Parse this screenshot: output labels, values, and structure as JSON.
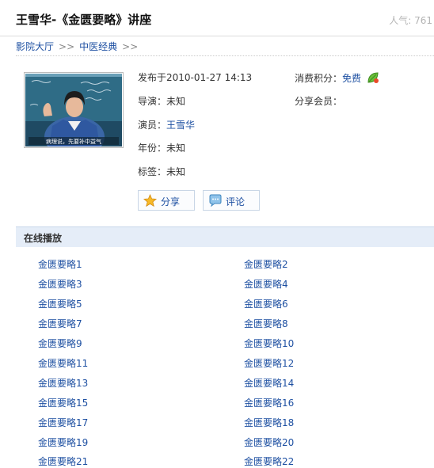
{
  "header": {
    "title": "王雪华-《金匮要略》讲座",
    "views_label": "人气",
    "views": "761"
  },
  "breadcrumb": {
    "items": [
      "影院大厅",
      "中医经典"
    ],
    "separator": ">>"
  },
  "poster": {
    "caption": "病理说，先要补中益气"
  },
  "info": {
    "published_label": "发布于",
    "published": "2010-01-27 14:13",
    "cost_label": "消费积分：",
    "cost_value": "免费",
    "director_label": "导演：",
    "director": "未知",
    "sharer_label": "分享会员：",
    "actor_label": "演员：",
    "actor": "王雪华",
    "year_label": "年份：",
    "year": "未知",
    "tags_label": "标签：",
    "tags": "未知"
  },
  "actions": {
    "share": "分享",
    "comment": "评论"
  },
  "online": {
    "heading": "在线播放",
    "episodes": [
      "金匮要略1",
      "金匮要略2",
      "金匮要略3",
      "金匮要略4",
      "金匮要略5",
      "金匮要略6",
      "金匮要略7",
      "金匮要略8",
      "金匮要略9",
      "金匮要略10",
      "金匮要略11",
      "金匮要略12",
      "金匮要略13",
      "金匮要略14",
      "金匮要略15",
      "金匮要略16",
      "金匮要略17",
      "金匮要略18",
      "金匮要略19",
      "金匮要略20",
      "金匮要略21",
      "金匮要略22"
    ]
  },
  "icons": {
    "leaf": "leaf-icon",
    "star": "star-icon",
    "comment": "comment-icon"
  },
  "colors": {
    "link": "#1e50a2",
    "section_bg": "#e5edf8"
  }
}
